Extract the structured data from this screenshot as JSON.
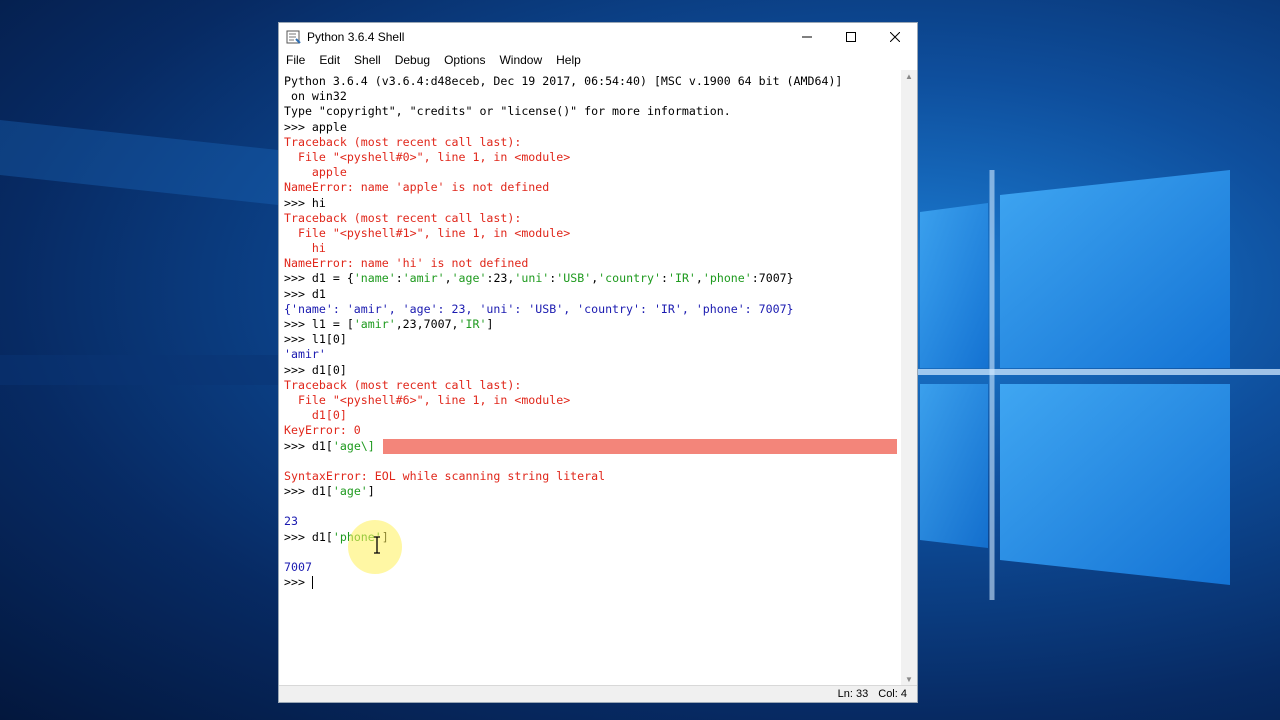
{
  "window": {
    "title": "Python 3.6.4 Shell"
  },
  "menu": [
    "File",
    "Edit",
    "Shell",
    "Debug",
    "Options",
    "Window",
    "Help"
  ],
  "shell_lines": [
    {
      "parts": [
        {
          "c": "std",
          "t": "Python 3.6.4 (v3.6.4:d48eceb, Dec 19 2017, 06:54:40) [MSC v.1900 64 bit (AMD64)]"
        }
      ]
    },
    {
      "parts": [
        {
          "c": "std",
          "t": " on win32"
        }
      ]
    },
    {
      "parts": [
        {
          "c": "std",
          "t": "Type \"copyright\", \"credits\" or \"license()\" for more information."
        }
      ]
    },
    {
      "parts": [
        {
          "c": "std",
          "t": ">>> apple"
        }
      ]
    },
    {
      "parts": [
        {
          "c": "err",
          "t": "Traceback (most recent call last):"
        }
      ]
    },
    {
      "parts": [
        {
          "c": "err",
          "t": "  File \"<pyshell#0>\", line 1, in <module>"
        }
      ]
    },
    {
      "parts": [
        {
          "c": "err",
          "t": "    apple"
        }
      ]
    },
    {
      "parts": [
        {
          "c": "err",
          "t": "NameError: name 'apple' is not defined"
        }
      ]
    },
    {
      "parts": [
        {
          "c": "std",
          "t": ">>> hi"
        }
      ]
    },
    {
      "parts": [
        {
          "c": "err",
          "t": "Traceback (most recent call last):"
        }
      ]
    },
    {
      "parts": [
        {
          "c": "err",
          "t": "  File \"<pyshell#1>\", line 1, in <module>"
        }
      ]
    },
    {
      "parts": [
        {
          "c": "err",
          "t": "    hi"
        }
      ]
    },
    {
      "parts": [
        {
          "c": "err",
          "t": "NameError: name 'hi' is not defined"
        }
      ]
    },
    {
      "parts": [
        {
          "c": "std",
          "t": ">>> d1 = {"
        },
        {
          "c": "str",
          "t": "'name'"
        },
        {
          "c": "std",
          "t": ":"
        },
        {
          "c": "str",
          "t": "'amir'"
        },
        {
          "c": "std",
          "t": ","
        },
        {
          "c": "str",
          "t": "'age'"
        },
        {
          "c": "std",
          "t": ":23,"
        },
        {
          "c": "str",
          "t": "'uni'"
        },
        {
          "c": "std",
          "t": ":"
        },
        {
          "c": "str",
          "t": "'USB'"
        },
        {
          "c": "std",
          "t": ","
        },
        {
          "c": "str",
          "t": "'country'"
        },
        {
          "c": "std",
          "t": ":"
        },
        {
          "c": "str",
          "t": "'IR'"
        },
        {
          "c": "std",
          "t": ","
        },
        {
          "c": "str",
          "t": "'phone'"
        },
        {
          "c": "std",
          "t": ":7007}"
        }
      ]
    },
    {
      "parts": [
        {
          "c": "std",
          "t": ">>> d1"
        }
      ]
    },
    {
      "parts": [
        {
          "c": "out",
          "t": "{'name': 'amir', 'age': 23, 'uni': 'USB', 'country': 'IR', 'phone': 7007}"
        }
      ]
    },
    {
      "parts": [
        {
          "c": "std",
          "t": ">>> l1 = ["
        },
        {
          "c": "str",
          "t": "'amir'"
        },
        {
          "c": "std",
          "t": ",23,7007,"
        },
        {
          "c": "str",
          "t": "'IR'"
        },
        {
          "c": "std",
          "t": "]"
        }
      ]
    },
    {
      "parts": [
        {
          "c": "std",
          "t": ">>> l1[0]"
        }
      ]
    },
    {
      "parts": [
        {
          "c": "out",
          "t": "'amir'"
        }
      ]
    },
    {
      "parts": [
        {
          "c": "std",
          "t": ">>> d1[0]"
        }
      ]
    },
    {
      "parts": [
        {
          "c": "err",
          "t": "Traceback (most recent call last):"
        }
      ]
    },
    {
      "parts": [
        {
          "c": "err",
          "t": "  File \"<pyshell#6>\", line 1, in <module>"
        }
      ]
    },
    {
      "parts": [
        {
          "c": "err",
          "t": "    d1[0]"
        }
      ]
    },
    {
      "parts": [
        {
          "c": "err",
          "t": "KeyError: 0"
        }
      ]
    },
    {
      "parts": [
        {
          "c": "std",
          "t": ">>> d1["
        },
        {
          "c": "str",
          "t": "'age\\]"
        }
      ],
      "highlight": true
    },
    {
      "parts": [
        {
          "c": "std",
          "t": ""
        }
      ]
    },
    {
      "parts": [
        {
          "c": "err",
          "t": "SyntaxError: EOL while scanning string literal"
        }
      ]
    },
    {
      "parts": [
        {
          "c": "std",
          "t": ">>> d1["
        },
        {
          "c": "str",
          "t": "'age'"
        },
        {
          "c": "std",
          "t": "]"
        }
      ]
    },
    {
      "parts": [
        {
          "c": "std",
          "t": ""
        }
      ]
    },
    {
      "parts": [
        {
          "c": "out",
          "t": "23"
        }
      ]
    },
    {
      "parts": [
        {
          "c": "std",
          "t": ">>> d1["
        },
        {
          "c": "str",
          "t": "'phone'"
        },
        {
          "c": "std",
          "t": "]"
        }
      ]
    },
    {
      "parts": [
        {
          "c": "std",
          "t": ""
        }
      ]
    },
    {
      "parts": [
        {
          "c": "out",
          "t": "7007"
        }
      ]
    },
    {
      "parts": [
        {
          "c": "std",
          "t": ">>> "
        }
      ],
      "cursor": true
    }
  ],
  "status": {
    "line": "Ln: 33",
    "col": "Col: 4"
  },
  "icons": {
    "app": "python-idle-icon",
    "minimize": "minimize-icon",
    "maximize": "maximize-icon",
    "close": "close-icon"
  },
  "colors": {
    "prompt_text": "#000000",
    "output": "#1a1ab0",
    "error": "#e0271b",
    "string": "#1e9a1e",
    "highlight": "#f3857a"
  }
}
